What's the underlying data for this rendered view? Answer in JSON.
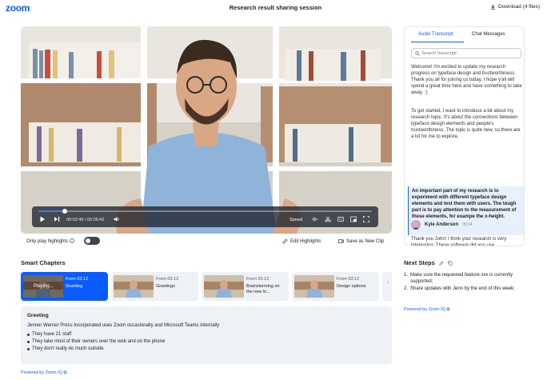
{
  "header": {
    "logo": "zoom",
    "title": "Research result sharing session",
    "download_label": "Download (4 files)"
  },
  "player": {
    "time": "00:02:46 / 00:06:42",
    "progress_fraction": 0.08,
    "speed_label": "Speed"
  },
  "below_video": {
    "toggle_label": "Only play highlights",
    "toggle_on": false,
    "edit_highlights": "Edit Highlights",
    "save_clip": "Save as New Clip"
  },
  "smart_chapters": {
    "title": "Smart Chapters",
    "chapters": [
      {
        "from": "From 03:12",
        "name": "Greeting",
        "overlay": "Playing..."
      },
      {
        "from": "From 03:12",
        "name": "Greetings"
      },
      {
        "from": "From 03:12",
        "name": "Brainstorming on the new lo..."
      },
      {
        "from": "From 03:12",
        "name": "Design options"
      }
    ]
  },
  "summary": {
    "title": "Greeting",
    "body": "Jenner Werner Press Incorporated uses Zoom occasionally and Microsoft Teams internally",
    "bullets": [
      "They have 21 staff",
      "They take most of their owners over the web and on the phone",
      "They don't really do much outside"
    ],
    "powered_by": "Powered by Zoom IQ"
  },
  "transcript": {
    "tabs": [
      "Audio Transcript",
      "Chat Messages"
    ],
    "search_placeholder": "Search transcript",
    "paragraphs": [
      "Welcome! I'm excited to update my research progress on typeface design and trustworthiness. Thank you all for joining us today. I hope y'all will spend a great time here and have something to take away. :)",
      "To get started, I want to introduce a bit about my research topic. It's about the connections between typeface design elements and people's trustworthiness. The topic is quite new, so there are a lot for me to explore."
    ],
    "highlight": "An important part of my research is to experiment with different typeface design elements and test them with users. The tough part is to pay attention to the measurement of these elements, for exampe the x-height.",
    "speaker_name": "Kyle Anderson",
    "speaker_time": "05:14",
    "speaker_text": "Thank you John! I think your research is very interesting. These software did you use"
  },
  "next_steps": {
    "title": "Next Steps",
    "items": [
      {
        "num": "1.",
        "text": "Make sure the requested feature xxx is currently supported;"
      },
      {
        "num": "2.",
        "text": "Share updates with Jenn by the end of this week;"
      }
    ],
    "powered_by": "Powered by Zoom IQ"
  },
  "colors": {
    "accent": "#0b5cff",
    "chapter_bg": "#eef1f5",
    "controls_bg": "#1e232d"
  }
}
